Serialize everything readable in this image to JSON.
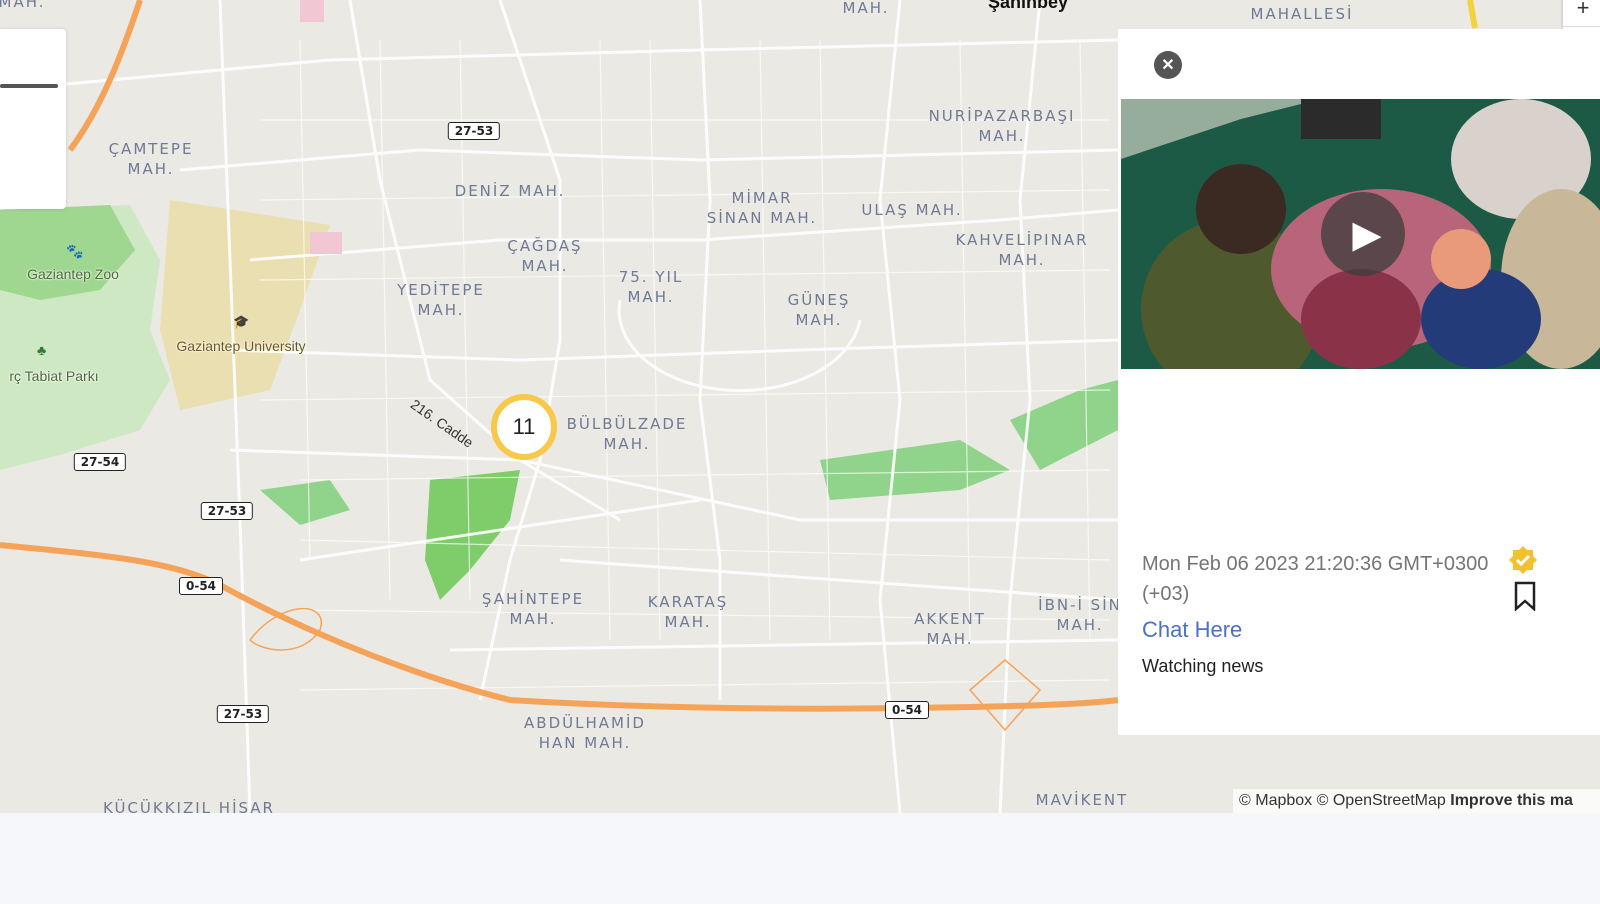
{
  "map": {
    "districts": [
      {
        "id": "camtepe",
        "label": "ÇAMTEPE\nMAH."
      },
      {
        "id": "deniz",
        "label": "DENİZ MAH."
      },
      {
        "id": "mimar-sinan",
        "label": "MİMAR\nSİNAN MAH."
      },
      {
        "id": "ulas",
        "label": "ULAŞ MAH."
      },
      {
        "id": "nuripazarbasi",
        "label": "NURİPAZARBAŞI\nMAH."
      },
      {
        "id": "kahvelipinar",
        "label": "KAHVELİPINAR\nMAH."
      },
      {
        "id": "cagdas",
        "label": "ÇAĞDAŞ\nMAH."
      },
      {
        "id": "yeditepe",
        "label": "YEDİTEPE\nMAH."
      },
      {
        "id": "75-yil",
        "label": "75. YIL\nMAH."
      },
      {
        "id": "gunes",
        "label": "GÜNEŞ\nMAH."
      },
      {
        "id": "bulbulzade",
        "label": "BÜLBÜLZADE\nMAH."
      },
      {
        "id": "sahintepe",
        "label": "ŞAHİNTEPE\nMAH."
      },
      {
        "id": "karatas",
        "label": "KARATAŞ\nMAH."
      },
      {
        "id": "akkent",
        "label": "AKKENT\nMAH."
      },
      {
        "id": "ibn-i-sina",
        "label": "İBN-İ SİN\nMAH."
      },
      {
        "id": "abdulhamid-han",
        "label": "ABDÜLHAMİD\nHAN MAH."
      },
      {
        "id": "mavikent",
        "label": "MAVİKENT"
      },
      {
        "id": "kucukkizil-hisar",
        "label": "KÜÇÜKKIZIL HİSAR"
      },
      {
        "id": "top-mah",
        "label": "MAH."
      },
      {
        "id": "top-mahallesi",
        "label": "MAHALLESİ"
      },
      {
        "id": "top-left-mah",
        "label": "MAH."
      }
    ],
    "top_city": "Şahinbey",
    "pois": [
      {
        "id": "zoo",
        "label": "Gaziantep Zoo",
        "icon": "zoo-icon"
      },
      {
        "id": "university",
        "label": "Gaziantep University",
        "icon": "graduation-cap-icon"
      },
      {
        "id": "park",
        "label": "rç Tabiat Parkı",
        "icon": "tree-icon"
      }
    ],
    "road_shields": [
      "27-53",
      "27-54",
      "27-53",
      "0-54",
      "27-53",
      "0-54"
    ],
    "street_label": "216. Cadde",
    "cluster_count": "11",
    "colors": {
      "background": "#ebe9e4",
      "park": "#8fd48a",
      "highway": "#f6a35a",
      "cluster": "#f8c84b"
    }
  },
  "controls": {
    "zoom_in": "+",
    "zoom_out": "−",
    "compass": "▲"
  },
  "panel": {
    "close_icon": "✕",
    "timestamp": "Mon Feb 06 2023 21:20:36 GMT+0300 (+03)",
    "chat_link": "Chat Here",
    "caption": "Watching news",
    "verified_color": "#f2c12e"
  },
  "attribution": {
    "mapbox": "© Mapbox",
    "osm": "© OpenStreetMap",
    "improve": "Improve this ma"
  }
}
